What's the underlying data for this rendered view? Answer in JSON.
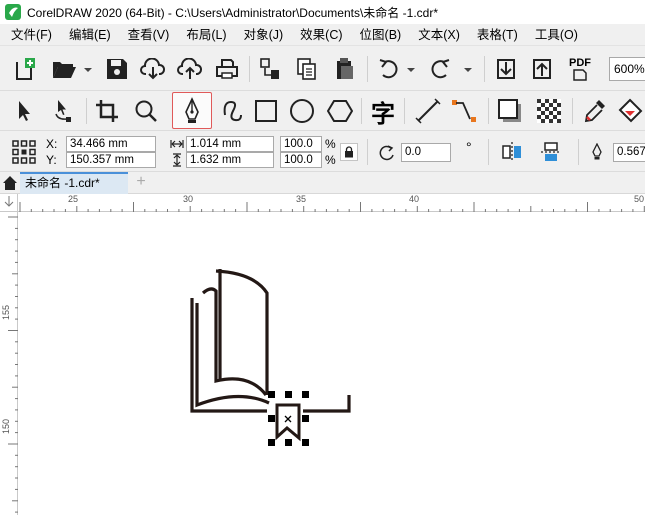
{
  "window": {
    "title": "CorelDRAW 2020 (64-Bit) - C:\\Users\\Administrator\\Documents\\未命名 -1.cdr*"
  },
  "menu": [
    {
      "label": "文件(F)"
    },
    {
      "label": "编辑(E)"
    },
    {
      "label": "查看(V)"
    },
    {
      "label": "布局(L)"
    },
    {
      "label": "对象(J)"
    },
    {
      "label": "效果(C)"
    },
    {
      "label": "位图(B)"
    },
    {
      "label": "文本(X)"
    },
    {
      "label": "表格(T)"
    },
    {
      "label": "工具(O)"
    }
  ],
  "standard_toolbar": {
    "zoom_value": "600%",
    "pdf_label": "PDF"
  },
  "toolbox": {
    "active_tool": "pen-tool",
    "text_tool_glyph": "字"
  },
  "property_bar": {
    "x_label": "X:",
    "x_value": "34.466 mm",
    "y_label": "Y:",
    "y_value": "150.357 mm",
    "width_value": "1.014 mm",
    "height_value": "1.632 mm",
    "scale_x": "100.0",
    "scale_y": "100.0",
    "percent_x": "%",
    "percent_y": "%",
    "rotation_value": "0.0",
    "degree_symbol": "°",
    "outline_width": "0.567"
  },
  "document_tabs": {
    "active_tab": "未命名 -1.cdr*"
  },
  "rulers": {
    "horizontal": [
      "25",
      "30",
      "35",
      "40",
      "50"
    ],
    "vertical": [
      "155",
      "150"
    ]
  },
  "colors": {
    "accent": "#4a90d9",
    "active_tool_border": "#e05a5a",
    "drawing_stroke": "#231815",
    "logo_green": "#2aa84a"
  }
}
